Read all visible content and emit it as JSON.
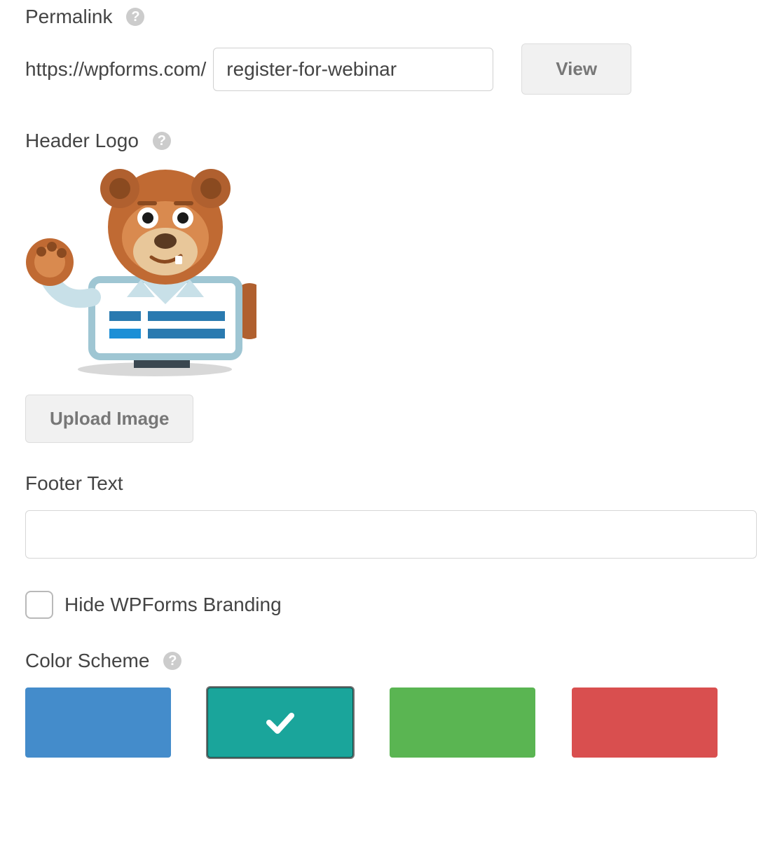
{
  "permalink": {
    "label": "Permalink",
    "prefix": "https://wpforms.com/",
    "slug": "register-for-webinar",
    "view_label": "View"
  },
  "header_logo": {
    "label": "Header Logo",
    "upload_label": "Upload Image"
  },
  "footer_text": {
    "label": "Footer Text",
    "value": ""
  },
  "hide_branding": {
    "label": "Hide WPForms Branding",
    "checked": false
  },
  "color_scheme": {
    "label": "Color Scheme",
    "options": [
      {
        "name": "blue",
        "hex": "#448ccb",
        "selected": false
      },
      {
        "name": "teal",
        "hex": "#1aa59b",
        "selected": true
      },
      {
        "name": "green",
        "hex": "#5ab552",
        "selected": false
      },
      {
        "name": "red",
        "hex": "#d94f4f",
        "selected": false
      }
    ]
  }
}
